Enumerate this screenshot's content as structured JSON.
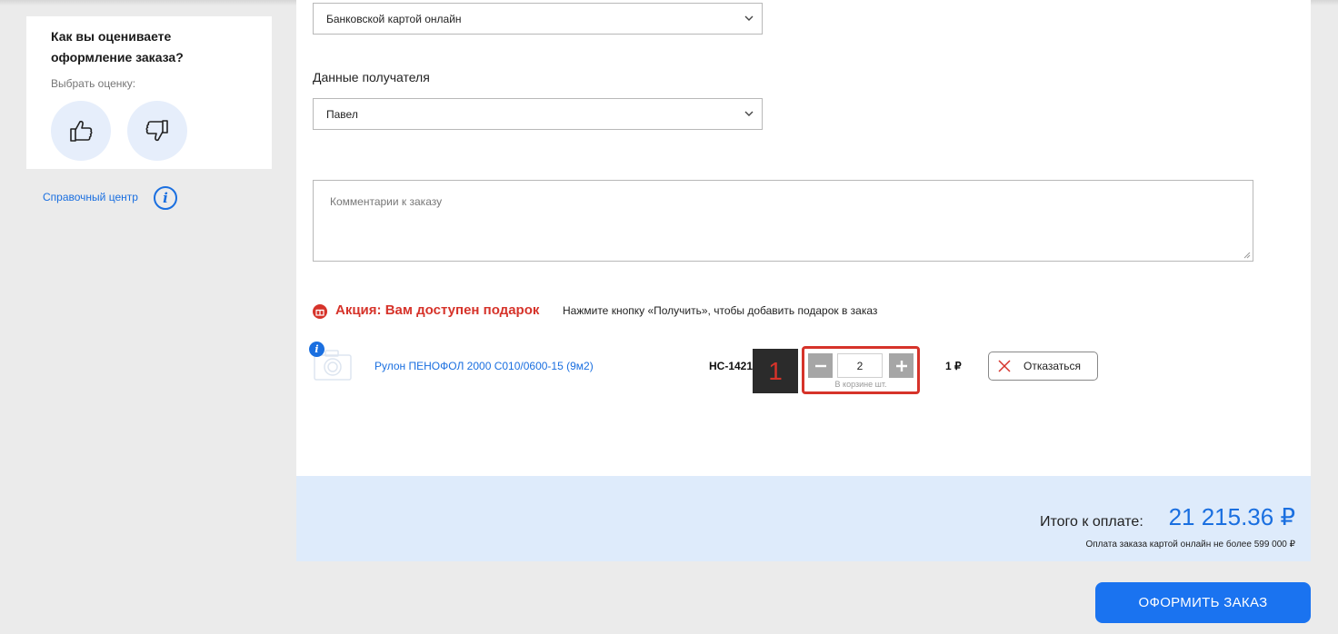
{
  "rating": {
    "title": "Как вы оцениваете оформление заказа?",
    "subtitle": "Выбрать оценку:",
    "like_icon": "thumbs-up-icon",
    "dislike_icon": "thumbs-down-icon"
  },
  "help": {
    "label": "Справочный центр",
    "icon": "info-icon"
  },
  "form": {
    "payment_method": "Банковской картой онлайн",
    "recipient_label": "Данные получателя",
    "recipient_value": "Павел",
    "comment_placeholder": "Комментарии к заказу"
  },
  "promo": {
    "icon": "gift-icon",
    "title": "Акция: Вам доступен подарок",
    "hint": "Нажмите кнопку «Получить», чтобы добавить подарок в заказ",
    "color": "#d6332a"
  },
  "gift_item": {
    "name": "Рулон ПЕНОФОЛ 2000 С010/0600-15 (9м2)",
    "code": "НС-1421830",
    "overlay_number": "1",
    "quantity": "2",
    "quantity_caption": "В корзине шт.",
    "price": "1 ₽",
    "decline_label": "Отказаться"
  },
  "total": {
    "label": "Итого к оплате:",
    "value": "21 215.36 ₽",
    "note": "Оплата заказа картой онлайн не более 599 000 ₽"
  },
  "submit_label": "ОФОРМИТЬ ЗАКАЗ",
  "colors": {
    "accent_blue": "#1a73f0",
    "link_blue": "#1a6fe0",
    "total_bg": "#deebfb",
    "page_bg": "#ebebeb"
  }
}
